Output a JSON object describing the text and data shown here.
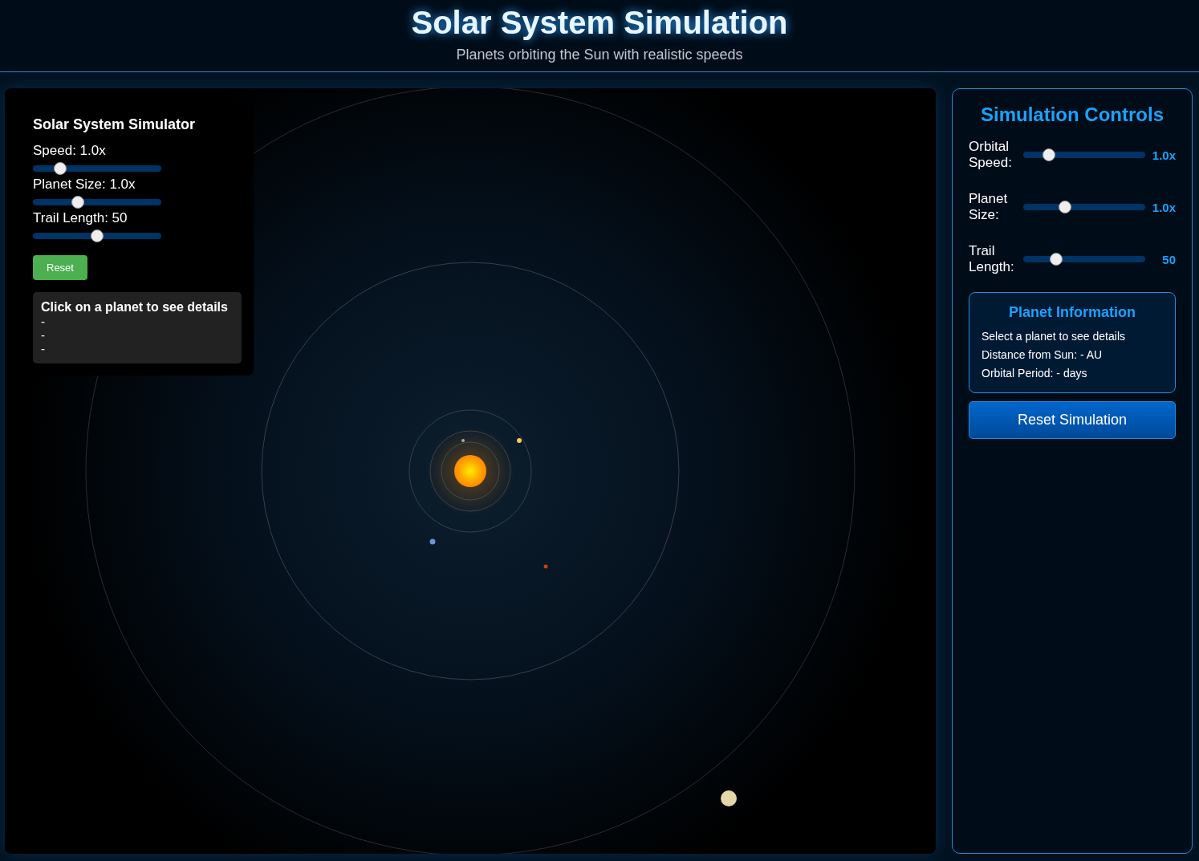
{
  "header": {
    "title": "Solar System Simulation",
    "subtitle": "Planets orbiting the Sun with realistic speeds"
  },
  "overlay": {
    "title": "Solar System Simulator",
    "sliders": [
      {
        "label": "Speed: 1.0x",
        "level": 0.21
      },
      {
        "label": "Planet Size: 1.0x",
        "level": 0.35
      },
      {
        "label": "Trail Length: 50",
        "level": 0.5
      }
    ],
    "reset_button": "Reset",
    "details": {
      "title": "Click on a planet to see details",
      "lines": [
        "-",
        "-",
        "-"
      ]
    }
  },
  "controls": {
    "title": "Simulation Controls",
    "sliders": [
      {
        "label": "Orbital Speed:",
        "level": 0.21,
        "reading": "1.0x"
      },
      {
        "label": "Planet Size:",
        "level": 0.34,
        "reading": "1.0x"
      },
      {
        "label": "Trail Length:",
        "level": 0.27,
        "reading": "50"
      }
    ],
    "planet_info": {
      "title": "Planet Information",
      "lines": [
        "Select a planet to see details",
        "Distance from Sun: - AU",
        "Orbital Period: - days"
      ]
    },
    "reset_button": "Reset Simulation"
  }
}
